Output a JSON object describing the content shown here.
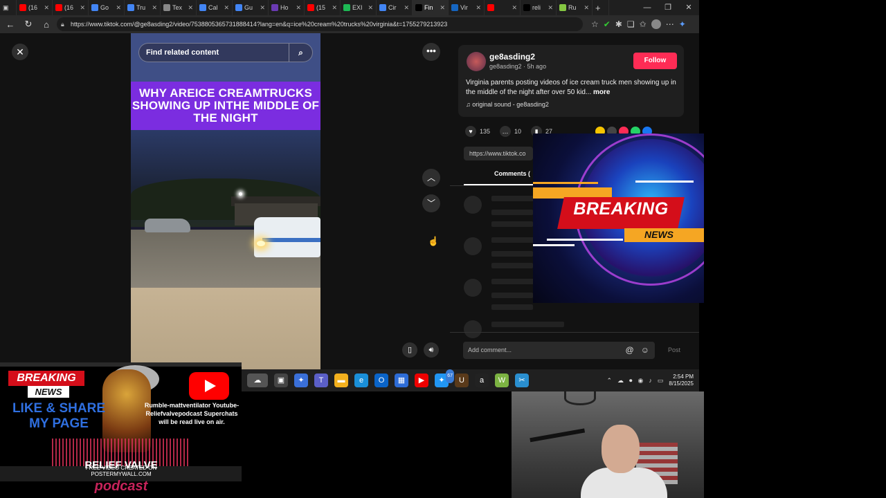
{
  "browser": {
    "tabs": [
      {
        "label": "(16",
        "color": "#ff0000"
      },
      {
        "label": "(16",
        "color": "#ff0000"
      },
      {
        "label": "Go",
        "color": "#4285f4"
      },
      {
        "label": "Tru",
        "color": "#4285f4"
      },
      {
        "label": "Tex",
        "color": "#888888"
      },
      {
        "label": "Cal",
        "color": "#4285f4"
      },
      {
        "label": "Gu",
        "color": "#4285f4"
      },
      {
        "label": "Ho",
        "color": "#6a3ab2"
      },
      {
        "label": "(15",
        "color": "#ff0000"
      },
      {
        "label": "EXI",
        "color": "#1db954"
      },
      {
        "label": "Cir",
        "color": "#4285f4"
      },
      {
        "label": "Fin",
        "color": "#000000",
        "active": true
      },
      {
        "label": "Vir",
        "color": "#1565c0"
      },
      {
        "label": "",
        "color": "#ff0000"
      },
      {
        "label": "reli",
        "color": "#000000"
      },
      {
        "label": "Ru",
        "color": "#85c742"
      }
    ],
    "url": "https://www.tiktok.com/@ge8asding2/video/7538805365731888414?lang=en&q=ice%20cream%20trucks%20virginia&t=1755279213923"
  },
  "video": {
    "search_placeholder": "Find related content",
    "caption": "WHY AREICE CREAMTRUCKS SHOWING UP INTHE MIDDLE OF THE NIGHT"
  },
  "side": {
    "username": "ge8asding2",
    "subline": "ge8asding2 · 5h ago",
    "follow_label": "Follow",
    "description": "Virginia parents posting videos of ice cream truck men showing up in the middle of the night after over 50 kid...",
    "more_label": "more",
    "sound": "original sound - ge8asding2",
    "likes": "135",
    "comments_count": "10",
    "saves": "27",
    "link_text": "https://www.tiktok.co",
    "comments_tab": "Comments (",
    "add_comment_placeholder": "Add comment...",
    "post_label": "Post"
  },
  "overlay": {
    "breaking": "BREAKING",
    "news": "NEWS"
  },
  "promo": {
    "breaking": "BREAKING",
    "news": "NEWS",
    "like_share": "LIKE & SHARE MY PAGE",
    "info": "Rumble-mattventilator Youtube-Reliefvalvepodcast Superchats will be read live on air.",
    "relief": "RELIEF VALVE",
    "free_video": "FREE VIDEO CREATED ON POSTERMYWALL.COM",
    "podcast": "podcast"
  },
  "taskbar": {
    "time": "2:54 PM",
    "date": "8/15/2025",
    "badge": "67"
  }
}
